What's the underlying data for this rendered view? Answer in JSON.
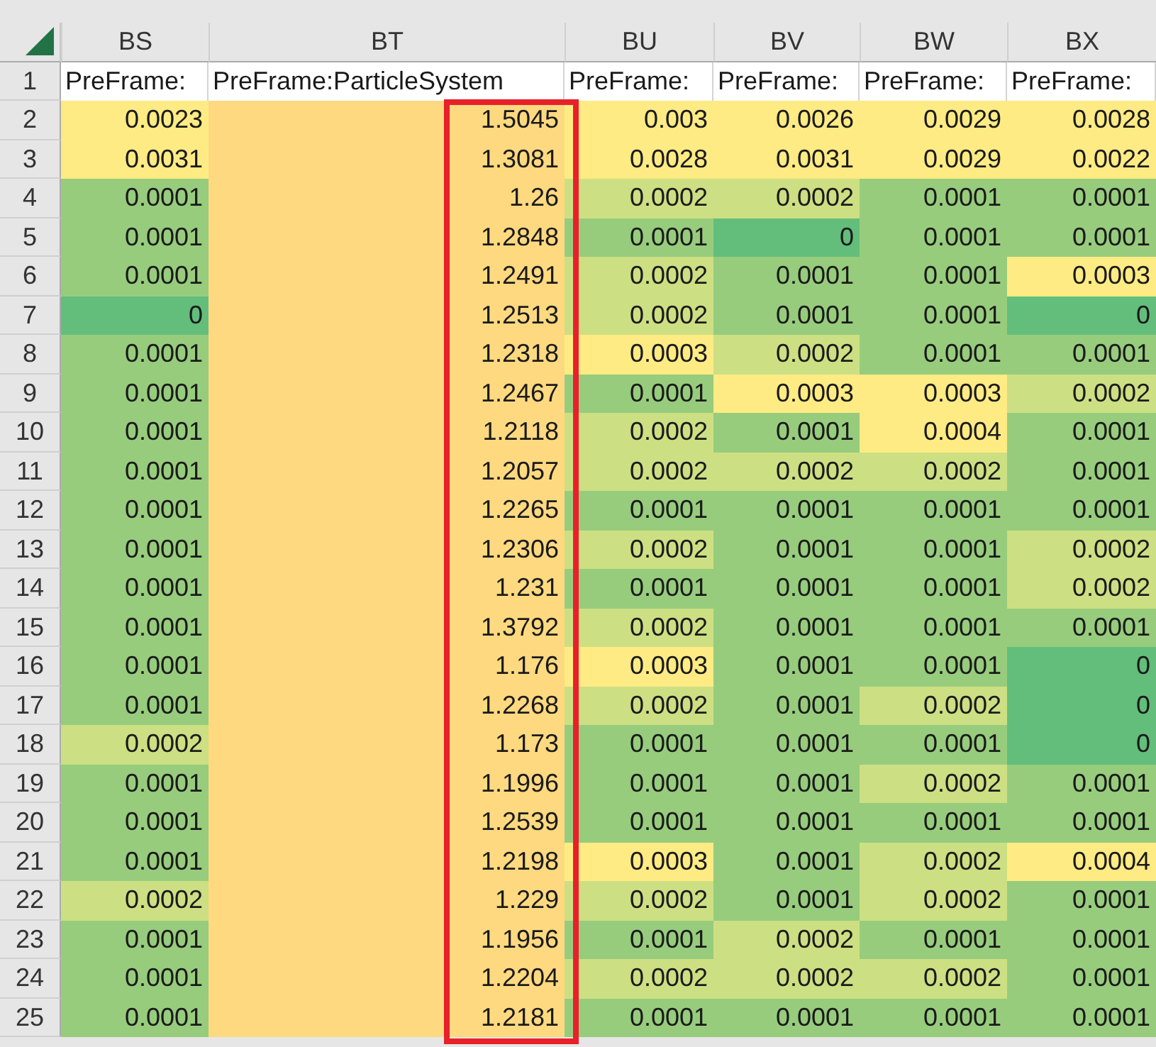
{
  "columns": [
    {
      "label": "BS",
      "highlighted": false
    },
    {
      "label": "BT",
      "highlighted": true
    },
    {
      "label": "BU",
      "highlighted": false
    },
    {
      "label": "BV",
      "highlighted": false
    },
    {
      "label": "BW",
      "highlighted": false
    },
    {
      "label": "BX",
      "highlighted": false
    }
  ],
  "header_row": {
    "number": "1",
    "cells": [
      "PreFrame:",
      "PreFrame:ParticleSystem",
      "PreFrame:",
      "PreFrame:",
      "PreFrame:",
      "PreFrame:"
    ]
  },
  "rows": [
    {
      "number": "2",
      "cells": [
        {
          "value": "0.0023",
          "color": "#ffeb84"
        },
        {
          "value": "1.5045",
          "color": "#fed980"
        },
        {
          "value": "0.003",
          "color": "#ffeb84"
        },
        {
          "value": "0.0026",
          "color": "#ffeb84"
        },
        {
          "value": "0.0029",
          "color": "#ffeb84"
        },
        {
          "value": "0.0028",
          "color": "#ffeb84"
        }
      ]
    },
    {
      "number": "3",
      "cells": [
        {
          "value": "0.0031",
          "color": "#ffeb84"
        },
        {
          "value": "1.3081",
          "color": "#fed980"
        },
        {
          "value": "0.0028",
          "color": "#ffeb84"
        },
        {
          "value": "0.0031",
          "color": "#ffeb84"
        },
        {
          "value": "0.0029",
          "color": "#ffeb84"
        },
        {
          "value": "0.0022",
          "color": "#ffeb84"
        }
      ]
    },
    {
      "number": "4",
      "cells": [
        {
          "value": "0.0001",
          "color": "#97cc7d"
        },
        {
          "value": "1.26",
          "color": "#fed980"
        },
        {
          "value": "0.0002",
          "color": "#cddf83"
        },
        {
          "value": "0.0002",
          "color": "#cddf83"
        },
        {
          "value": "0.0001",
          "color": "#97cc7d"
        },
        {
          "value": "0.0001",
          "color": "#97cc7d"
        }
      ]
    },
    {
      "number": "5",
      "cells": [
        {
          "value": "0.0001",
          "color": "#97cc7d"
        },
        {
          "value": "1.2848",
          "color": "#fed980"
        },
        {
          "value": "0.0001",
          "color": "#97cc7d"
        },
        {
          "value": "0",
          "color": "#63be7b"
        },
        {
          "value": "0.0001",
          "color": "#97cc7d"
        },
        {
          "value": "0.0001",
          "color": "#97cc7d"
        }
      ]
    },
    {
      "number": "6",
      "cells": [
        {
          "value": "0.0001",
          "color": "#97cc7d"
        },
        {
          "value": "1.2491",
          "color": "#fed980"
        },
        {
          "value": "0.0002",
          "color": "#cddf83"
        },
        {
          "value": "0.0001",
          "color": "#97cc7d"
        },
        {
          "value": "0.0001",
          "color": "#97cc7d"
        },
        {
          "value": "0.0003",
          "color": "#ffeb84"
        }
      ]
    },
    {
      "number": "7",
      "cells": [
        {
          "value": "0",
          "color": "#63be7b"
        },
        {
          "value": "1.2513",
          "color": "#fed980"
        },
        {
          "value": "0.0002",
          "color": "#cddf83"
        },
        {
          "value": "0.0001",
          "color": "#97cc7d"
        },
        {
          "value": "0.0001",
          "color": "#97cc7d"
        },
        {
          "value": "0",
          "color": "#63be7b"
        }
      ]
    },
    {
      "number": "8",
      "cells": [
        {
          "value": "0.0001",
          "color": "#97cc7d"
        },
        {
          "value": "1.2318",
          "color": "#fed980"
        },
        {
          "value": "0.0003",
          "color": "#ffeb84"
        },
        {
          "value": "0.0002",
          "color": "#cddf83"
        },
        {
          "value": "0.0001",
          "color": "#97cc7d"
        },
        {
          "value": "0.0001",
          "color": "#97cc7d"
        }
      ]
    },
    {
      "number": "9",
      "cells": [
        {
          "value": "0.0001",
          "color": "#97cc7d"
        },
        {
          "value": "1.2467",
          "color": "#fed980"
        },
        {
          "value": "0.0001",
          "color": "#97cc7d"
        },
        {
          "value": "0.0003",
          "color": "#ffeb84"
        },
        {
          "value": "0.0003",
          "color": "#ffeb84"
        },
        {
          "value": "0.0002",
          "color": "#cddf83"
        }
      ]
    },
    {
      "number": "10",
      "cells": [
        {
          "value": "0.0001",
          "color": "#97cc7d"
        },
        {
          "value": "1.2118",
          "color": "#fed980"
        },
        {
          "value": "0.0002",
          "color": "#cddf83"
        },
        {
          "value": "0.0001",
          "color": "#97cc7d"
        },
        {
          "value": "0.0004",
          "color": "#ffeb84"
        },
        {
          "value": "0.0001",
          "color": "#97cc7d"
        }
      ]
    },
    {
      "number": "11",
      "cells": [
        {
          "value": "0.0001",
          "color": "#97cc7d"
        },
        {
          "value": "1.2057",
          "color": "#fed980"
        },
        {
          "value": "0.0002",
          "color": "#cddf83"
        },
        {
          "value": "0.0002",
          "color": "#cddf83"
        },
        {
          "value": "0.0002",
          "color": "#cddf83"
        },
        {
          "value": "0.0001",
          "color": "#97cc7d"
        }
      ]
    },
    {
      "number": "12",
      "cells": [
        {
          "value": "0.0001",
          "color": "#97cc7d"
        },
        {
          "value": "1.2265",
          "color": "#fed980"
        },
        {
          "value": "0.0001",
          "color": "#97cc7d"
        },
        {
          "value": "0.0001",
          "color": "#97cc7d"
        },
        {
          "value": "0.0001",
          "color": "#97cc7d"
        },
        {
          "value": "0.0001",
          "color": "#97cc7d"
        }
      ]
    },
    {
      "number": "13",
      "cells": [
        {
          "value": "0.0001",
          "color": "#97cc7d"
        },
        {
          "value": "1.2306",
          "color": "#fed980"
        },
        {
          "value": "0.0002",
          "color": "#cddf83"
        },
        {
          "value": "0.0001",
          "color": "#97cc7d"
        },
        {
          "value": "0.0001",
          "color": "#97cc7d"
        },
        {
          "value": "0.0002",
          "color": "#cddf83"
        }
      ]
    },
    {
      "number": "14",
      "cells": [
        {
          "value": "0.0001",
          "color": "#97cc7d"
        },
        {
          "value": "1.231",
          "color": "#fed980"
        },
        {
          "value": "0.0001",
          "color": "#97cc7d"
        },
        {
          "value": "0.0001",
          "color": "#97cc7d"
        },
        {
          "value": "0.0001",
          "color": "#97cc7d"
        },
        {
          "value": "0.0002",
          "color": "#cddf83"
        }
      ]
    },
    {
      "number": "15",
      "cells": [
        {
          "value": "0.0001",
          "color": "#97cc7d"
        },
        {
          "value": "1.3792",
          "color": "#fed980"
        },
        {
          "value": "0.0002",
          "color": "#cddf83"
        },
        {
          "value": "0.0001",
          "color": "#97cc7d"
        },
        {
          "value": "0.0001",
          "color": "#97cc7d"
        },
        {
          "value": "0.0001",
          "color": "#97cc7d"
        }
      ]
    },
    {
      "number": "16",
      "cells": [
        {
          "value": "0.0001",
          "color": "#97cc7d"
        },
        {
          "value": "1.176",
          "color": "#fed980"
        },
        {
          "value": "0.0003",
          "color": "#ffeb84"
        },
        {
          "value": "0.0001",
          "color": "#97cc7d"
        },
        {
          "value": "0.0001",
          "color": "#97cc7d"
        },
        {
          "value": "0",
          "color": "#63be7b"
        }
      ]
    },
    {
      "number": "17",
      "cells": [
        {
          "value": "0.0001",
          "color": "#97cc7d"
        },
        {
          "value": "1.2268",
          "color": "#fed980"
        },
        {
          "value": "0.0002",
          "color": "#cddf83"
        },
        {
          "value": "0.0001",
          "color": "#97cc7d"
        },
        {
          "value": "0.0002",
          "color": "#cddf83"
        },
        {
          "value": "0",
          "color": "#63be7b"
        }
      ]
    },
    {
      "number": "18",
      "cells": [
        {
          "value": "0.0002",
          "color": "#cddf83"
        },
        {
          "value": "1.173",
          "color": "#fed980"
        },
        {
          "value": "0.0001",
          "color": "#97cc7d"
        },
        {
          "value": "0.0001",
          "color": "#97cc7d"
        },
        {
          "value": "0.0001",
          "color": "#97cc7d"
        },
        {
          "value": "0",
          "color": "#63be7b"
        }
      ]
    },
    {
      "number": "19",
      "cells": [
        {
          "value": "0.0001",
          "color": "#97cc7d"
        },
        {
          "value": "1.1996",
          "color": "#fed980"
        },
        {
          "value": "0.0001",
          "color": "#97cc7d"
        },
        {
          "value": "0.0001",
          "color": "#97cc7d"
        },
        {
          "value": "0.0002",
          "color": "#cddf83"
        },
        {
          "value": "0.0001",
          "color": "#97cc7d"
        }
      ]
    },
    {
      "number": "20",
      "cells": [
        {
          "value": "0.0001",
          "color": "#97cc7d"
        },
        {
          "value": "1.2539",
          "color": "#fed980"
        },
        {
          "value": "0.0001",
          "color": "#97cc7d"
        },
        {
          "value": "0.0001",
          "color": "#97cc7d"
        },
        {
          "value": "0.0001",
          "color": "#97cc7d"
        },
        {
          "value": "0.0001",
          "color": "#97cc7d"
        }
      ]
    },
    {
      "number": "21",
      "cells": [
        {
          "value": "0.0001",
          "color": "#97cc7d"
        },
        {
          "value": "1.2198",
          "color": "#fed980"
        },
        {
          "value": "0.0003",
          "color": "#ffeb84"
        },
        {
          "value": "0.0001",
          "color": "#97cc7d"
        },
        {
          "value": "0.0002",
          "color": "#cddf83"
        },
        {
          "value": "0.0004",
          "color": "#ffeb84"
        }
      ]
    },
    {
      "number": "22",
      "cells": [
        {
          "value": "0.0002",
          "color": "#cddf83"
        },
        {
          "value": "1.229",
          "color": "#fed980"
        },
        {
          "value": "0.0002",
          "color": "#cddf83"
        },
        {
          "value": "0.0001",
          "color": "#97cc7d"
        },
        {
          "value": "0.0002",
          "color": "#cddf83"
        },
        {
          "value": "0.0001",
          "color": "#97cc7d"
        }
      ]
    },
    {
      "number": "23",
      "cells": [
        {
          "value": "0.0001",
          "color": "#97cc7d"
        },
        {
          "value": "1.1956",
          "color": "#fed980"
        },
        {
          "value": "0.0001",
          "color": "#97cc7d"
        },
        {
          "value": "0.0002",
          "color": "#cddf83"
        },
        {
          "value": "0.0001",
          "color": "#97cc7d"
        },
        {
          "value": "0.0001",
          "color": "#97cc7d"
        }
      ]
    },
    {
      "number": "24",
      "cells": [
        {
          "value": "0.0001",
          "color": "#97cc7d"
        },
        {
          "value": "1.2204",
          "color": "#fed980"
        },
        {
          "value": "0.0002",
          "color": "#cddf83"
        },
        {
          "value": "0.0002",
          "color": "#cddf83"
        },
        {
          "value": "0.0002",
          "color": "#cddf83"
        },
        {
          "value": "0.0001",
          "color": "#97cc7d"
        }
      ]
    },
    {
      "number": "25",
      "cells": [
        {
          "value": "0.0001",
          "color": "#97cc7d"
        },
        {
          "value": "1.2181",
          "color": "#fed980"
        },
        {
          "value": "0.0001",
          "color": "#97cc7d"
        },
        {
          "value": "0.0001",
          "color": "#97cc7d"
        },
        {
          "value": "0.0001",
          "color": "#97cc7d"
        },
        {
          "value": "0.0001",
          "color": "#97cc7d"
        }
      ]
    }
  ]
}
